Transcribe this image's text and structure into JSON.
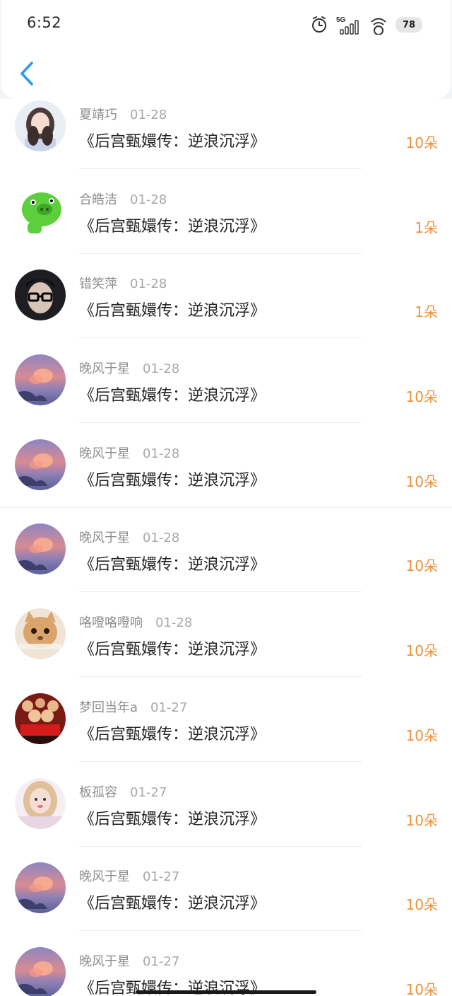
{
  "status_bar": {
    "time": "6:52",
    "network": "5G",
    "battery": "78"
  },
  "colors": {
    "accent_back": "#2a9bf0",
    "amount": "#f0913a"
  },
  "records": [
    {
      "name": "夏靖巧",
      "date": "01-28",
      "title": "《后宫甄嬛传：逆浪沉浮》",
      "amount": "10朵",
      "avatar": "girl-photo"
    },
    {
      "name": "合皓洁",
      "date": "01-28",
      "title": "《后宫甄嬛传：逆浪沉浮》",
      "amount": "1朵",
      "avatar": "green-pig"
    },
    {
      "name": "错笑萍",
      "date": "01-28",
      "title": "《后宫甄嬛传：逆浪沉浮》",
      "amount": "1朵",
      "avatar": "glasses-man"
    },
    {
      "name": "晚风于星",
      "date": "01-28",
      "title": "《后宫甄嬛传：逆浪沉浮》",
      "amount": "10朵",
      "avatar": "sunset-sky"
    },
    {
      "name": "晚风于星",
      "date": "01-28",
      "title": "《后宫甄嬛传：逆浪沉浮》",
      "amount": "10朵",
      "avatar": "sunset-sky"
    },
    {
      "name": "晚风于星",
      "date": "01-28",
      "title": "《后宫甄嬛传：逆浪沉浮》",
      "amount": "10朵",
      "avatar": "sunset-sky"
    },
    {
      "name": "咯噔咯噔响",
      "date": "01-28",
      "title": "《后宫甄嬛传：逆浪沉浮》",
      "amount": "10朵",
      "avatar": "cat-meme"
    },
    {
      "name": "梦回当年a",
      "date": "01-27",
      "title": "《后宫甄嬛传：逆浪沉浮》",
      "amount": "10朵",
      "avatar": "movie-poster"
    },
    {
      "name": "板孤容",
      "date": "01-27",
      "title": "《后宫甄嬛传：逆浪沉浮》",
      "amount": "10朵",
      "avatar": "blonde-girl"
    },
    {
      "name": "晚风于星",
      "date": "01-27",
      "title": "《后宫甄嬛传：逆浪沉浮》",
      "amount": "10朵",
      "avatar": "sunset-sky"
    },
    {
      "name": "晚风于星",
      "date": "01-27",
      "title": "《后宫甄嬛传：逆浪沉浮》",
      "amount": "10朵",
      "avatar": "sunset-sky"
    }
  ]
}
